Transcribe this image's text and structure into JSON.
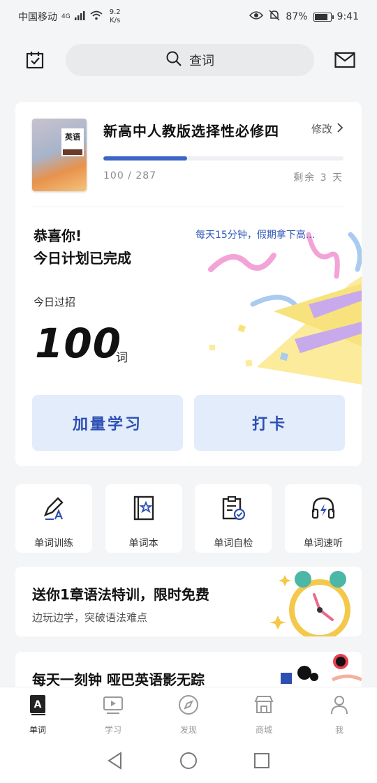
{
  "status_bar": {
    "carrier": "中国移动",
    "network": "4G",
    "speed_value": "9.2",
    "speed_unit": "K/s",
    "battery": "87%",
    "battery_level": 0.87,
    "time": "9:41"
  },
  "header": {
    "search_placeholder": "查词",
    "left_icon": "calendar-check-icon",
    "right_icon": "mail-icon"
  },
  "book": {
    "cover_title": "英语",
    "title": "新高中人教版选择性必修四",
    "edit_label": "修改",
    "progress_text": "100 / 287",
    "progress_done": 100,
    "progress_total": 287,
    "remaining": "剩余 3 天"
  },
  "today": {
    "congrats_line1": "恭喜你!",
    "congrats_line2": "今日计划已完成",
    "motto": "每天15分钟，假期拿下高...",
    "label": "今日过招",
    "count": "100",
    "unit": "词"
  },
  "actions": {
    "more_study": "加量学习",
    "checkin": "打卡"
  },
  "tools": [
    {
      "label": "单词训练",
      "icon": "pencil-a-icon"
    },
    {
      "label": "单词本",
      "icon": "notebook-star-icon"
    },
    {
      "label": "单词自检",
      "icon": "clipboard-check-icon"
    },
    {
      "label": "单词速听",
      "icon": "headphones-bolt-icon"
    }
  ],
  "promos": [
    {
      "title": "送你1章语法特训，限时免费",
      "subtitle": "边玩边学，突破语法难点"
    },
    {
      "title": "每天一刻钟 哑巴英语影无踪"
    }
  ],
  "tabs": [
    {
      "label": "单词",
      "icon": "dictionary-icon",
      "active": true
    },
    {
      "label": "学习",
      "icon": "video-icon",
      "active": false
    },
    {
      "label": "发现",
      "icon": "compass-icon",
      "active": false
    },
    {
      "label": "商城",
      "icon": "store-icon",
      "active": false
    },
    {
      "label": "我",
      "icon": "user-icon",
      "active": false
    }
  ],
  "colors": {
    "accent": "#2d4fb3",
    "button_bg": "#e3ecfa",
    "progress": "#3a65c7"
  }
}
